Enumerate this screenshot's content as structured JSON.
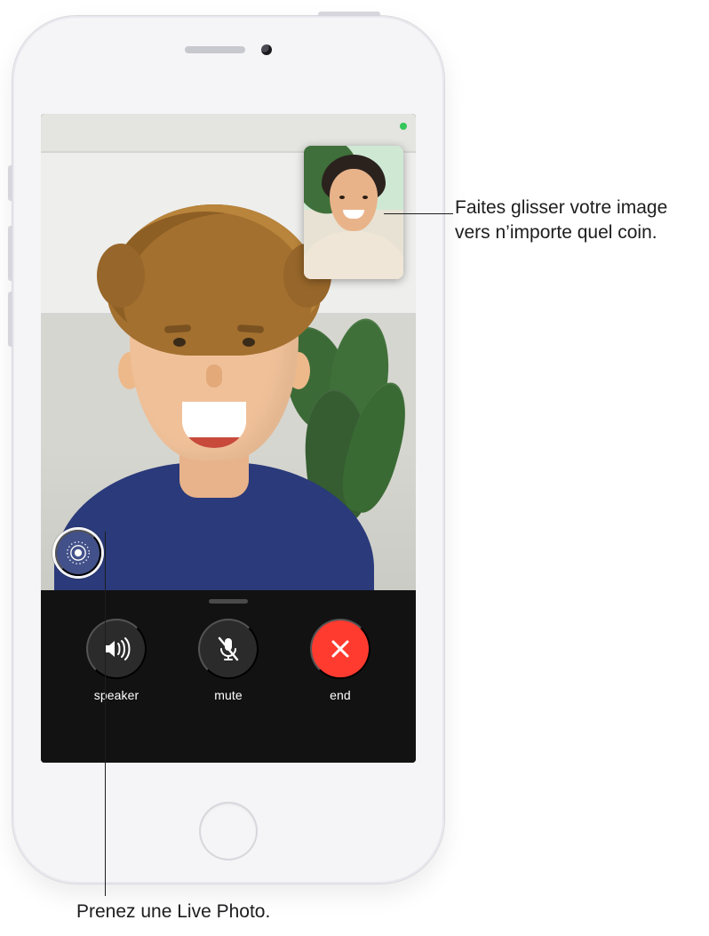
{
  "device": {
    "model": "iPod touch"
  },
  "facetime": {
    "status_indicator": "camera-active",
    "pip": {
      "description": "Self view",
      "corner": "top-right"
    },
    "live_photo": {
      "name": "live-photo-button"
    },
    "controls": {
      "speaker": {
        "label": "speaker"
      },
      "mute": {
        "label": "mute"
      },
      "end": {
        "label": "end"
      }
    }
  },
  "callouts": {
    "drag_pip": "Faites glisser votre image vers n’importe quel coin.",
    "live_photo": "Prenez une Live Photo."
  }
}
